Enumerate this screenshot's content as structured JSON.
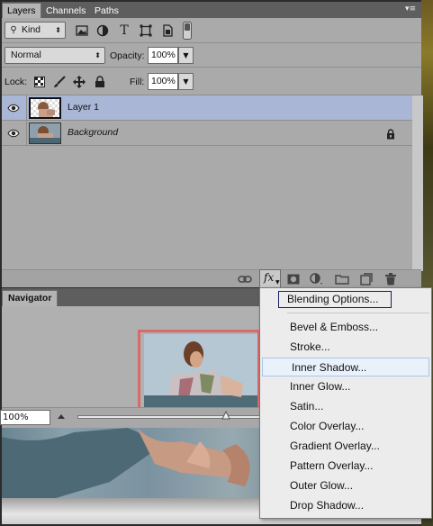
{
  "layers_panel": {
    "tabs": [
      "Layers",
      "Channels",
      "Paths"
    ],
    "filter": {
      "label": "Kind",
      "icon": "search-icon"
    },
    "filter_icons": [
      "image-filter-icon",
      "adjustment-filter-icon",
      "type-filter-icon",
      "shape-filter-icon",
      "smart-object-filter-icon",
      "filter-toggle-icon"
    ],
    "blend_mode": "Normal",
    "opacity_label": "Opacity:",
    "opacity_value": "100%",
    "lock_label": "Lock:",
    "lock_icons": [
      "lock-transparent-icon",
      "lock-image-icon",
      "lock-position-icon",
      "lock-all-icon"
    ],
    "fill_label": "Fill:",
    "fill_value": "100%",
    "layers": [
      {
        "name": "Layer 1",
        "selected": true,
        "visible": true,
        "italic": false,
        "locked": false
      },
      {
        "name": "Background",
        "selected": false,
        "visible": true,
        "italic": true,
        "locked": true
      }
    ],
    "footer_icons": [
      "link-icon",
      "fx-icon",
      "mask-icon",
      "adjustment-icon",
      "folder-icon",
      "new-layer-icon",
      "trash-icon"
    ]
  },
  "navigator_panel": {
    "tab": "Navigator",
    "zoom": "100%"
  },
  "fx_menu": {
    "blending_options": "Blending Options...",
    "items": [
      "Bevel & Emboss...",
      "Stroke...",
      "Inner Shadow...",
      "Inner Glow...",
      "Satin...",
      "Color Overlay...",
      "Gradient Overlay...",
      "Pattern Overlay...",
      "Outer Glow...",
      "Drop Shadow..."
    ],
    "highlighted": "Inner Shadow..."
  },
  "colors": {
    "panel_bg": "#aaaaaa",
    "selected_layer": "#a9b6d6",
    "menu_bg": "#ececec",
    "menu_highlight": "#e9f1fb",
    "navigator_frame": "#d96a6a"
  }
}
